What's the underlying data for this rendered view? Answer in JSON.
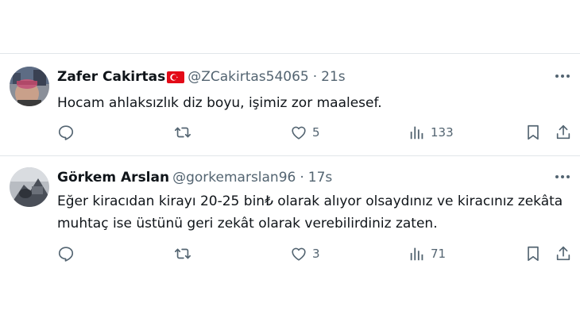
{
  "posts": [
    {
      "display_name": "Zafer Cakirtas",
      "handle": "@ZCakirtas54065",
      "separator": "·",
      "time": "21s",
      "text_lines": [
        "Hocam ahlaksızlık diz boyu, işimiz zor maalesef."
      ],
      "actions": {
        "reply_count": "",
        "repost_count": "",
        "like_count": "5",
        "views_count": "133"
      },
      "flag": "turkey-flag-icon"
    },
    {
      "display_name": "Görkem Arslan",
      "handle": "@gorkemarslan96",
      "separator": "·",
      "time": "17s",
      "text_lines": [
        "Eğer kiracıdan kirayı 20-25 bin₺ olarak alıyor olsaydınız ve kiracınız zekâta",
        "muhtaç ise üstünü geri zekât olarak verebilirdiniz zaten."
      ],
      "actions": {
        "reply_count": "",
        "repost_count": "",
        "like_count": "3",
        "views_count": "71"
      }
    }
  ],
  "colors": {
    "text": "#0f1419",
    "secondary": "#536471",
    "divider": "#e1e6ea",
    "flag_red": "#e30a17"
  },
  "icons": [
    "reply-icon",
    "repost-icon",
    "like-icon",
    "views-icon",
    "bookmark-icon",
    "share-icon",
    "more-icon"
  ]
}
